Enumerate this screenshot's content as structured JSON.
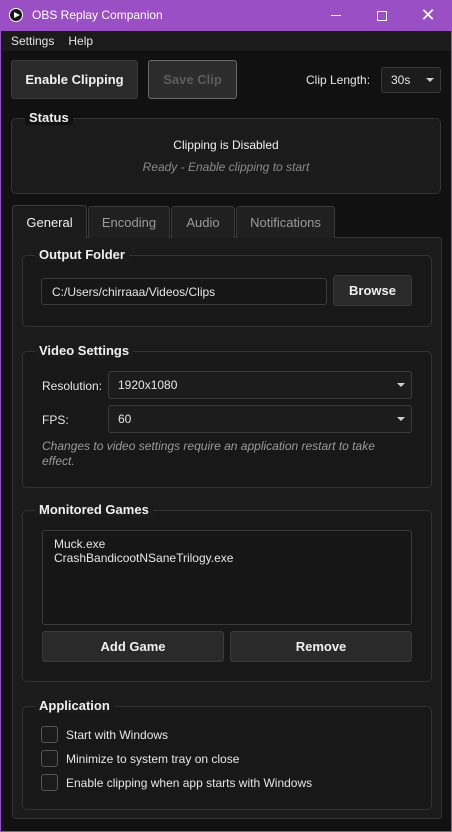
{
  "window": {
    "title": "OBS Replay Companion",
    "accent": "#9b4fc4",
    "icon": "obs-play-icon"
  },
  "menu": {
    "items": [
      "Settings",
      "Help"
    ]
  },
  "toolbar": {
    "enable_clipping": "Enable Clipping",
    "save_clip": "Save Clip",
    "clip_length_label": "Clip Length:",
    "clip_length_value": "30s"
  },
  "status": {
    "title": "Status",
    "state": "Clipping is Disabled",
    "hint": "Ready - Enable clipping to start"
  },
  "tabs": [
    {
      "label": "General",
      "active": true
    },
    {
      "label": "Encoding",
      "active": false
    },
    {
      "label": "Audio",
      "active": false
    },
    {
      "label": "Notifications",
      "active": false
    }
  ],
  "general": {
    "output_folder": {
      "title": "Output Folder",
      "path": "C:/Users/chirraaa/Videos/Clips",
      "browse": "Browse"
    },
    "video_settings": {
      "title": "Video Settings",
      "resolution_label": "Resolution:",
      "resolution_value": "1920x1080",
      "fps_label": "FPS:",
      "fps_value": "60",
      "note_line1": "Changes to video settings require an application restart to take",
      "note_line2": "effect."
    },
    "monitored_games": {
      "title": "Monitored Games",
      "games": [
        "Muck.exe",
        "CrashBandicootNSaneTrilogy.exe"
      ],
      "add": "Add Game",
      "remove": "Remove"
    },
    "application": {
      "title": "Application",
      "options": [
        {
          "label": "Start with Windows",
          "checked": false
        },
        {
          "label": "Minimize to system tray on close",
          "checked": false
        },
        {
          "label": "Enable clipping when app starts with Windows",
          "checked": false
        }
      ]
    }
  }
}
